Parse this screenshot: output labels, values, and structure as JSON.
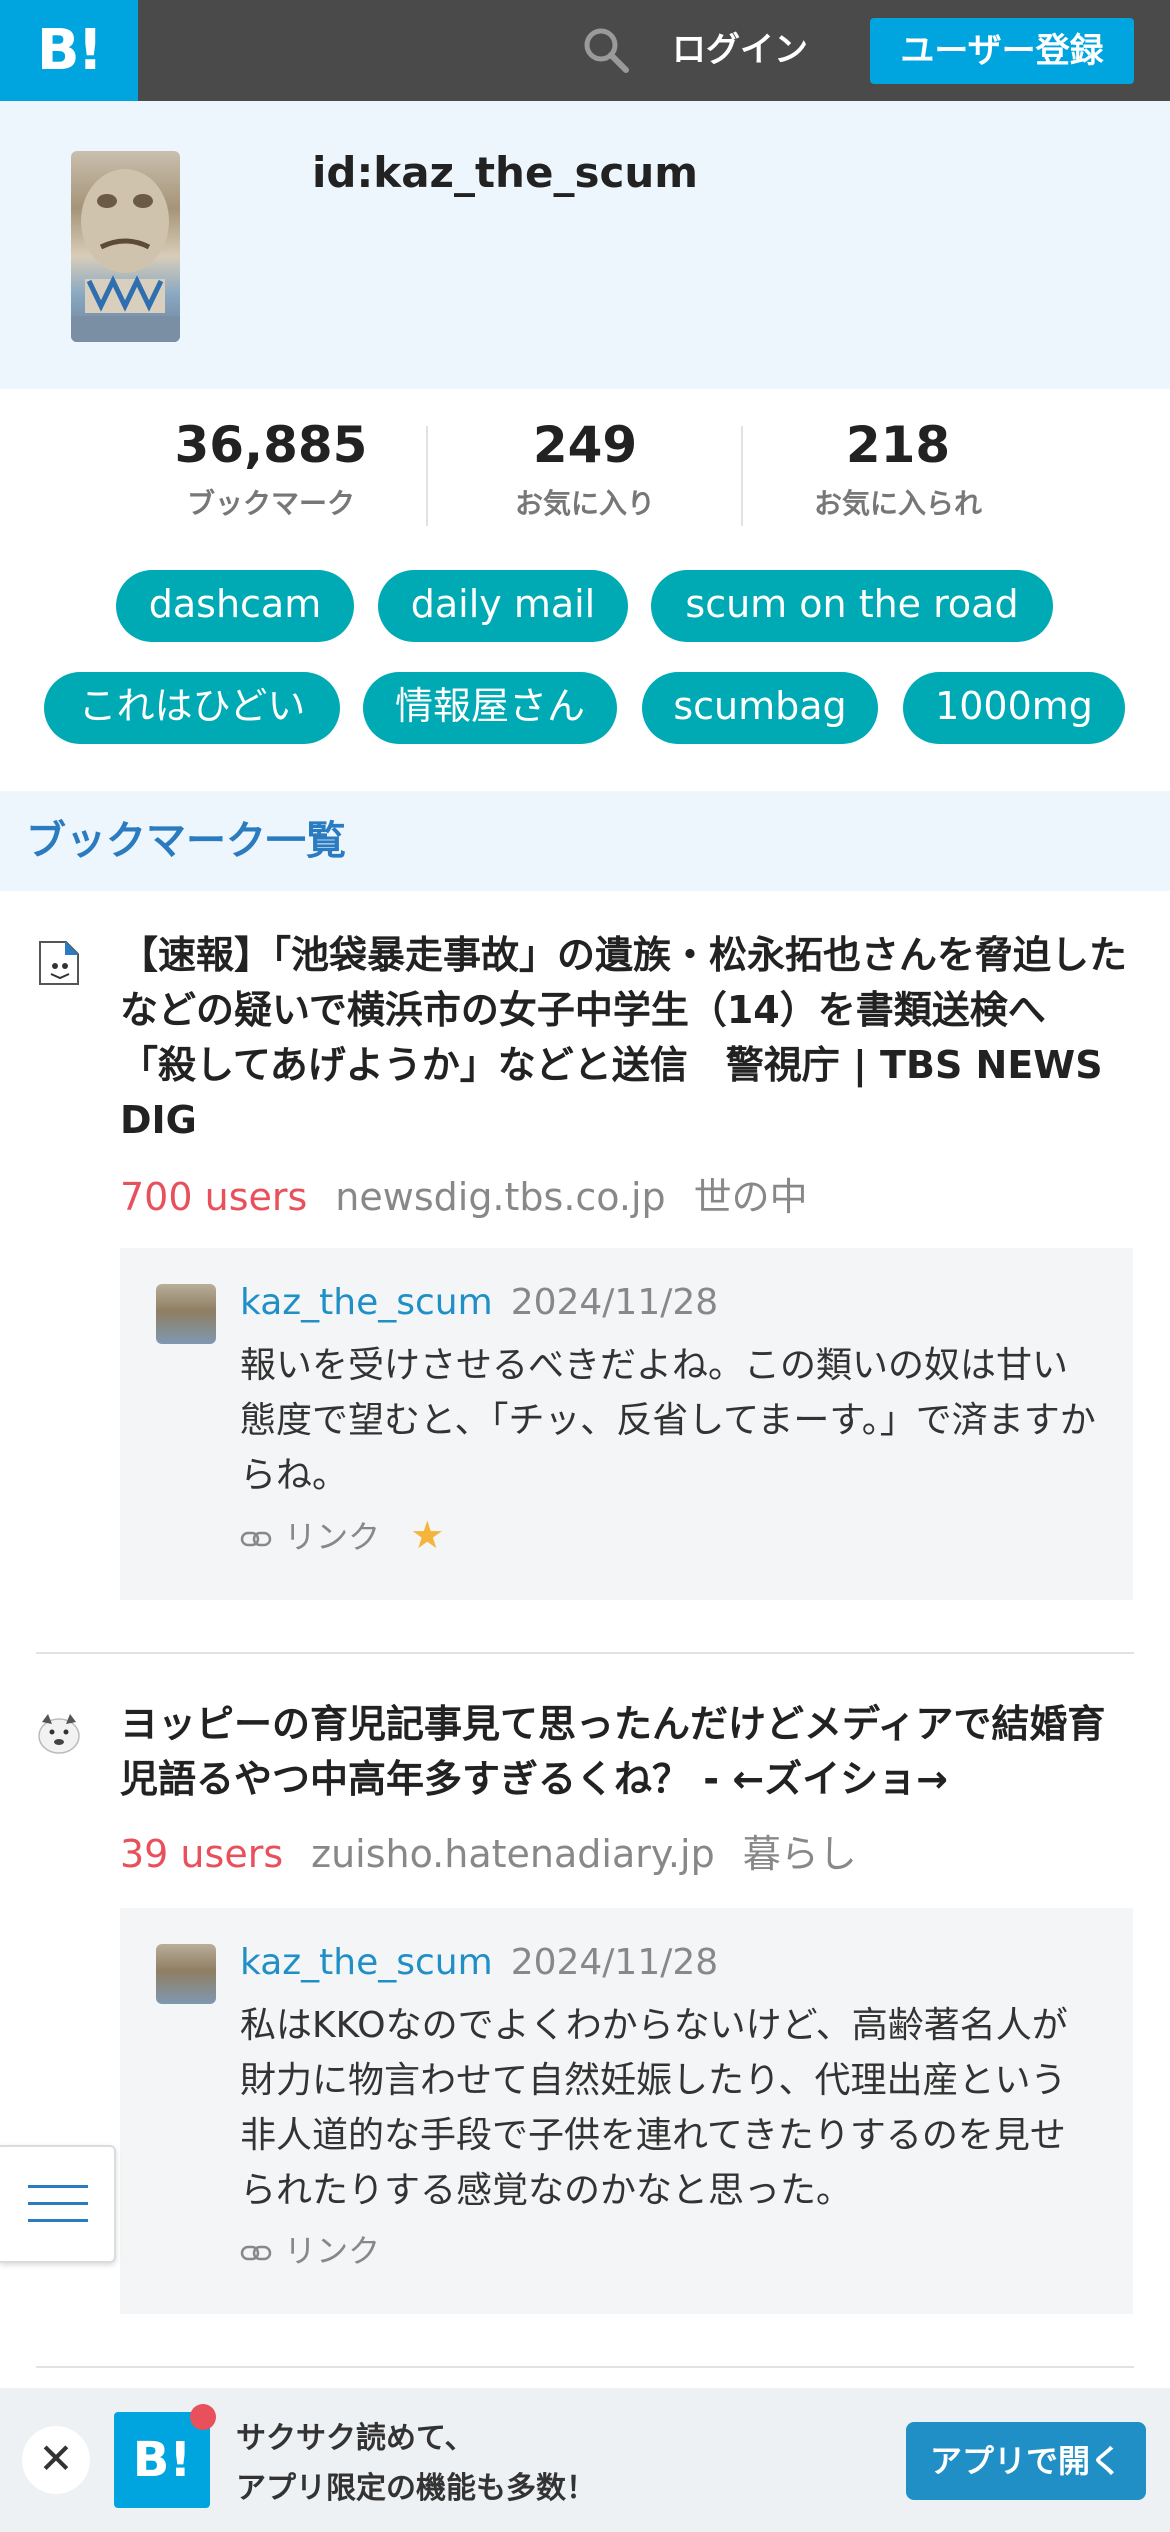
{
  "header": {
    "logo_text": "B!",
    "search_icon": "search-icon",
    "login_label": "ログイン",
    "register_label": "ユーザー登録",
    "bg_color": "#4a4a4a",
    "accent_color": "#00a4de"
  },
  "profile": {
    "user_id": "id:kaz_the_scum"
  },
  "stats": [
    {
      "value": "36,885",
      "label": "ブックマーク"
    },
    {
      "value": "249",
      "label": "お気に入り"
    },
    {
      "value": "218",
      "label": "お気に入られ"
    }
  ],
  "tags": [
    "dashcam",
    "daily mail",
    "scum on the road",
    "これはひどい",
    "情報屋さん",
    "scumbag",
    "1000mg"
  ],
  "section": {
    "title": "ブックマーク一覧"
  },
  "entries": [
    {
      "title": "【速報】「池袋暴走事故」の遺族・松永拓也さんを脅迫したなどの疑いで横浜市の女子中学生（14）を書類送検へ 「殺してあげようか」などと送信　警視庁 | TBS NEWS DIG",
      "users": "700 users",
      "domain": "newsdig.tbs.co.jp",
      "category": "世の中",
      "comment": {
        "user": "kaz_the_scum",
        "date": "2024/11/28",
        "text": "報いを受けさせるべきだよね。この類いの奴は甘い態度で望むと、「チッ、反省してまーす。」で済ますからね。",
        "link_label": "リンク",
        "has_star": true
      }
    },
    {
      "title": "ヨッピーの育児記事見て思ったんだけどメディアで結婚育児語るやつ中高年多すぎるくね？ - ←ズイショ→",
      "users": "39 users",
      "domain": "zuisho.hatenadiary.jp",
      "category": "暮らし",
      "comment": {
        "user": "kaz_the_scum",
        "date": "2024/11/28",
        "text": "私はKKOなのでよくわからないけど、高齢著名人が財力に物言わせて自然妊娠したり、代理出産という非人道的な手段で子供を連れてきたりするのを見せられたりする感覚なのかなと思った。",
        "link_label": "リンク",
        "has_star": false
      }
    }
  ],
  "app_banner": {
    "close_symbol": "✕",
    "logo_text": "B!",
    "line1": "サクサク読めて、",
    "line2": "アプリ限定の機能も多数！",
    "open_label": "アプリで開く"
  }
}
